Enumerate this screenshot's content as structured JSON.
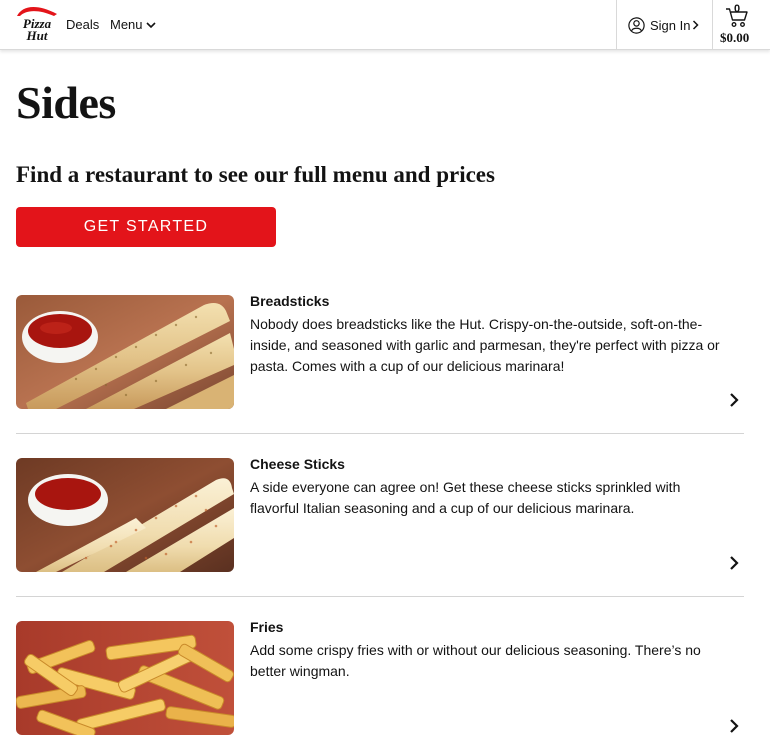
{
  "header": {
    "brand": "Pizza Hut",
    "logo_line1": "Pizza",
    "logo_line2": "Hut",
    "nav_deals": "Deals",
    "nav_menu": "Menu",
    "sign_in": "Sign In",
    "cart_count": "0",
    "cart_total": "$0.00"
  },
  "main": {
    "title": "Sides",
    "find_text": "Find a restaurant to see our full menu and prices",
    "cta_label": "GET STARTED",
    "items": [
      {
        "name": "Breadsticks",
        "description": "Nobody does breadsticks like the Hut. Crispy-on-the-outside, soft-on-the-inside, and seasoned with garlic and parmesan, they're perfect with pizza or pasta. Comes with a cup of our delicious marinara!",
        "image": "breadsticks-with-marinara"
      },
      {
        "name": "Cheese Sticks",
        "description": "A side everyone can agree on! Get these cheese sticks sprinkled with flavorful Italian seasoning and a cup of our delicious marinara.",
        "image": "cheese-sticks-with-marinara"
      },
      {
        "name": "Fries",
        "description": "Add some crispy fries with or without our delicious seasoning. There’s no better wingman.",
        "image": "fries"
      }
    ]
  },
  "colors": {
    "brand_red": "#e3141a",
    "text": "#131313",
    "divider": "#d4d4d4"
  }
}
